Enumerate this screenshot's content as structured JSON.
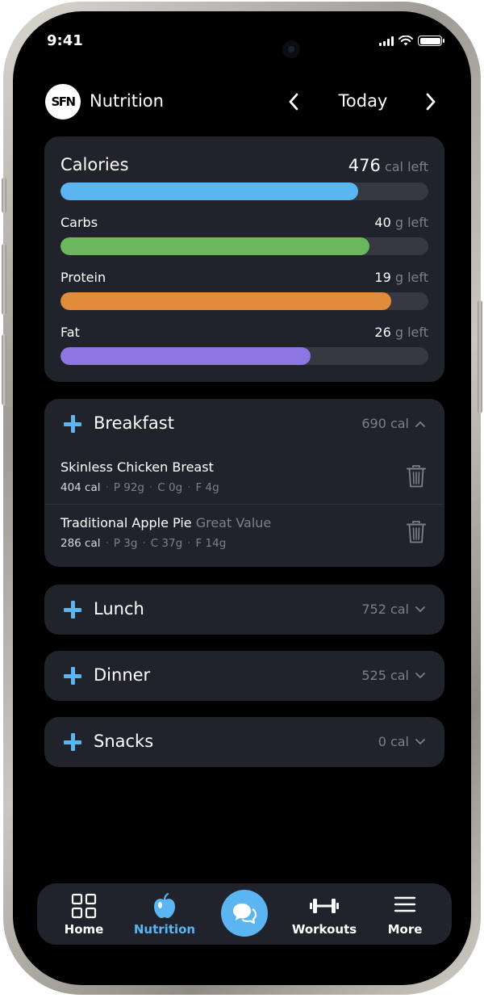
{
  "status": {
    "time": "9:41"
  },
  "header": {
    "app_name": "Nutrition",
    "logo_text": "SFN",
    "date_label": "Today"
  },
  "summary": {
    "calories": {
      "label": "Calories",
      "value": "476",
      "unit": "cal left",
      "fill": 0.81,
      "color": "#5bb5f0"
    },
    "macros": [
      {
        "label": "Carbs",
        "value": "40",
        "unit": "g left",
        "fill": 0.84,
        "color": "#6cb75b"
      },
      {
        "label": "Protein",
        "value": "19",
        "unit": "g left",
        "fill": 0.9,
        "color": "#e38b3c"
      },
      {
        "label": "Fat",
        "value": "26",
        "unit": "g left",
        "fill": 0.68,
        "color": "#8b76e4"
      }
    ]
  },
  "meals": [
    {
      "title": "Breakfast",
      "calories": "690 cal",
      "expanded": true,
      "items": [
        {
          "name": "Skinless Chicken Breast",
          "brand": "",
          "kcal": "404 cal",
          "protein": "P 92g",
          "carbs": "C 0g",
          "fat": "F 4g"
        },
        {
          "name": "Traditional Apple Pie",
          "brand": "Great Value",
          "kcal": "286 cal",
          "protein": "P 3g",
          "carbs": "C 37g",
          "fat": "F 14g"
        }
      ]
    },
    {
      "title": "Lunch",
      "calories": "752 cal",
      "expanded": false
    },
    {
      "title": "Dinner",
      "calories": "525 cal",
      "expanded": false
    },
    {
      "title": "Snacks",
      "calories": "0 cal",
      "expanded": false
    }
  ],
  "tabbar": {
    "tabs": [
      {
        "label": "Home",
        "icon": "grid-icon",
        "active": false
      },
      {
        "label": "Nutrition",
        "icon": "apple-icon",
        "active": true
      },
      {
        "label": "Workouts",
        "icon": "dumbbell-icon",
        "active": false
      },
      {
        "label": "More",
        "icon": "menu-icon",
        "active": false
      }
    ],
    "chat_icon": "chat-icon"
  },
  "colors": {
    "accent": "#5bb5f0",
    "card": "#20232b",
    "track": "#363942",
    "muted": "#7d8088"
  }
}
